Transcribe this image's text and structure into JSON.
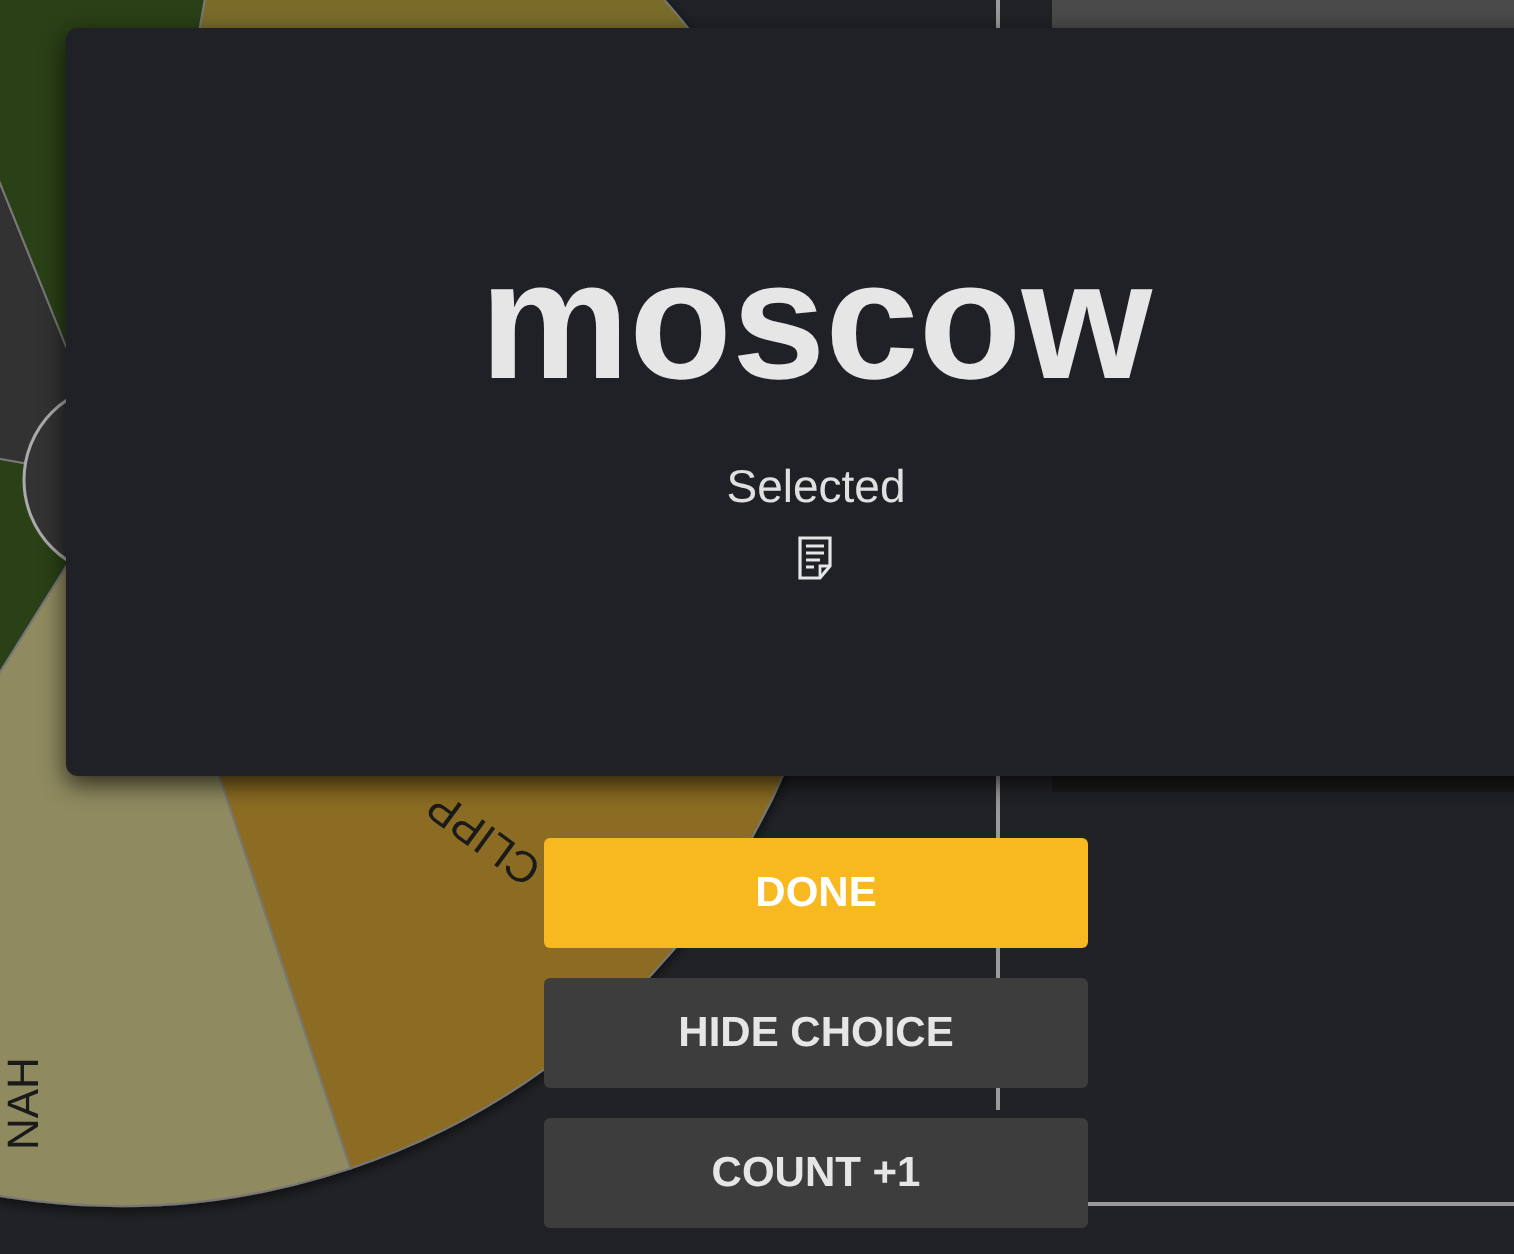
{
  "wheel": {
    "labels": [
      {
        "text": "CLIPP"
      },
      {
        "text": "NAH"
      }
    ]
  },
  "dialog": {
    "title": "moscow",
    "subtitle": "Selected"
  },
  "buttons": [
    {
      "label": "DONE",
      "kind": "primary"
    },
    {
      "label": "HIDE CHOICE",
      "kind": "secondary"
    },
    {
      "label": "COUNT +1",
      "kind": "secondary"
    }
  ]
}
